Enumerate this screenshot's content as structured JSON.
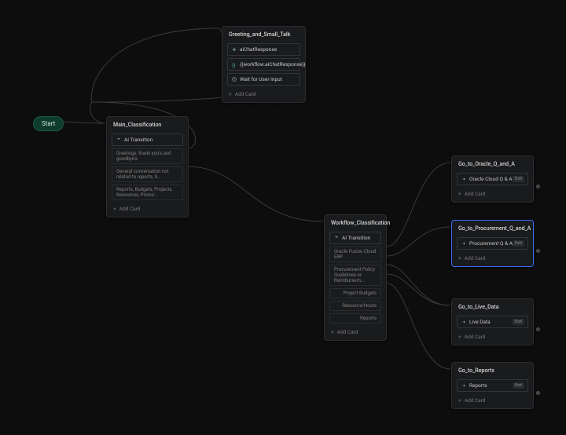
{
  "start": {
    "label": "Start"
  },
  "greeting": {
    "title": "Greeting_and_Small_Talk",
    "rows": [
      {
        "icon": "sparkle",
        "label": "aiChatResponse"
      },
      {
        "icon": "braces",
        "label": "{{workflow.aiChatResponse}}"
      },
      {
        "icon": "clock",
        "label": "Wait for User Input"
      }
    ],
    "add": "Add Card"
  },
  "main": {
    "title": "Main_Classification",
    "transition": "AI Transition",
    "subs": [
      "Greetings, thank you's and goodbye's",
      "General conversation not related to reports, b…",
      "Reports, Budgets, Projects, Resources, Procur…"
    ],
    "add": "Add Card"
  },
  "workflow": {
    "title": "Workflow_Classification",
    "transition": "AI Transition",
    "subs": [
      "Oracle Fusion Cloud ERP",
      "Procurement Policy Guidelines or Reimbursem…",
      "Project Budgets",
      "Resource/Hours",
      "Reports"
    ],
    "add": "Add Card"
  },
  "oracle": {
    "title": "Go_to_Oracle_Q_and_A",
    "row": "Oracle Cloud Q & A",
    "badge": "Exit",
    "add": "Add Card"
  },
  "procurement": {
    "title": "Go_to_Procurement_Q_and_A",
    "row": "Procurement Q & A",
    "badge": "Exit",
    "add": "Add Card"
  },
  "live": {
    "title": "Go_to_Live_Data",
    "row": "Live Data",
    "badge": "Exit",
    "add": "Add Card"
  },
  "reports": {
    "title": "Go_to_Reports",
    "row": "Reports",
    "badge": "Exit",
    "add": "Add Card"
  }
}
